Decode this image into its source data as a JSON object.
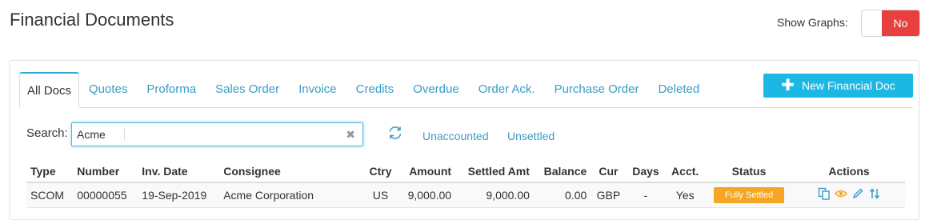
{
  "page": {
    "title": "Financial Documents"
  },
  "graphs": {
    "label": "Show Graphs:",
    "toggle_value": "No"
  },
  "tabs": [
    {
      "label": "All Docs",
      "active": true
    },
    {
      "label": "Quotes"
    },
    {
      "label": "Proforma"
    },
    {
      "label": "Sales Order"
    },
    {
      "label": "Invoice"
    },
    {
      "label": "Credits"
    },
    {
      "label": "Overdue"
    },
    {
      "label": "Order Ack."
    },
    {
      "label": "Purchase Order"
    },
    {
      "label": "Deleted"
    }
  ],
  "new_doc_button": {
    "label": "New Financial Doc"
  },
  "search": {
    "label": "Search:",
    "value": "Acme",
    "placeholder": ""
  },
  "filters": {
    "unaccounted": "Unaccounted",
    "unsettled": "Unsettled"
  },
  "table": {
    "headers": {
      "type": "Type",
      "number": "Number",
      "inv_date": "Inv. Date",
      "consignee": "Consignee",
      "ctry": "Ctry",
      "amount": "Amount",
      "settled_amt": "Settled Amt",
      "balance": "Balance",
      "cur": "Cur",
      "days": "Days",
      "acct": "Acct.",
      "status": "Status",
      "actions": "Actions"
    },
    "rows": [
      {
        "type": "SCOM",
        "number": "00000055",
        "inv_date": "19-Sep-2019",
        "consignee": "Acme Corporation",
        "ctry": "US",
        "amount": "9,000.00",
        "settled_amt": "9,000.00",
        "balance": "0.00",
        "cur": "GBP",
        "days": "-",
        "acct": "Yes",
        "status": "Fully Settled"
      }
    ]
  },
  "colors": {
    "accent": "#1bb8e3",
    "link": "#3a9cc6",
    "toggle_no": "#e8403f",
    "status_fully_settled": "#f5a623"
  },
  "icons": [
    "refresh-icon",
    "clear-icon",
    "plus-icon",
    "copy-icon",
    "eye-icon",
    "pencil-icon",
    "swap-icon"
  ]
}
